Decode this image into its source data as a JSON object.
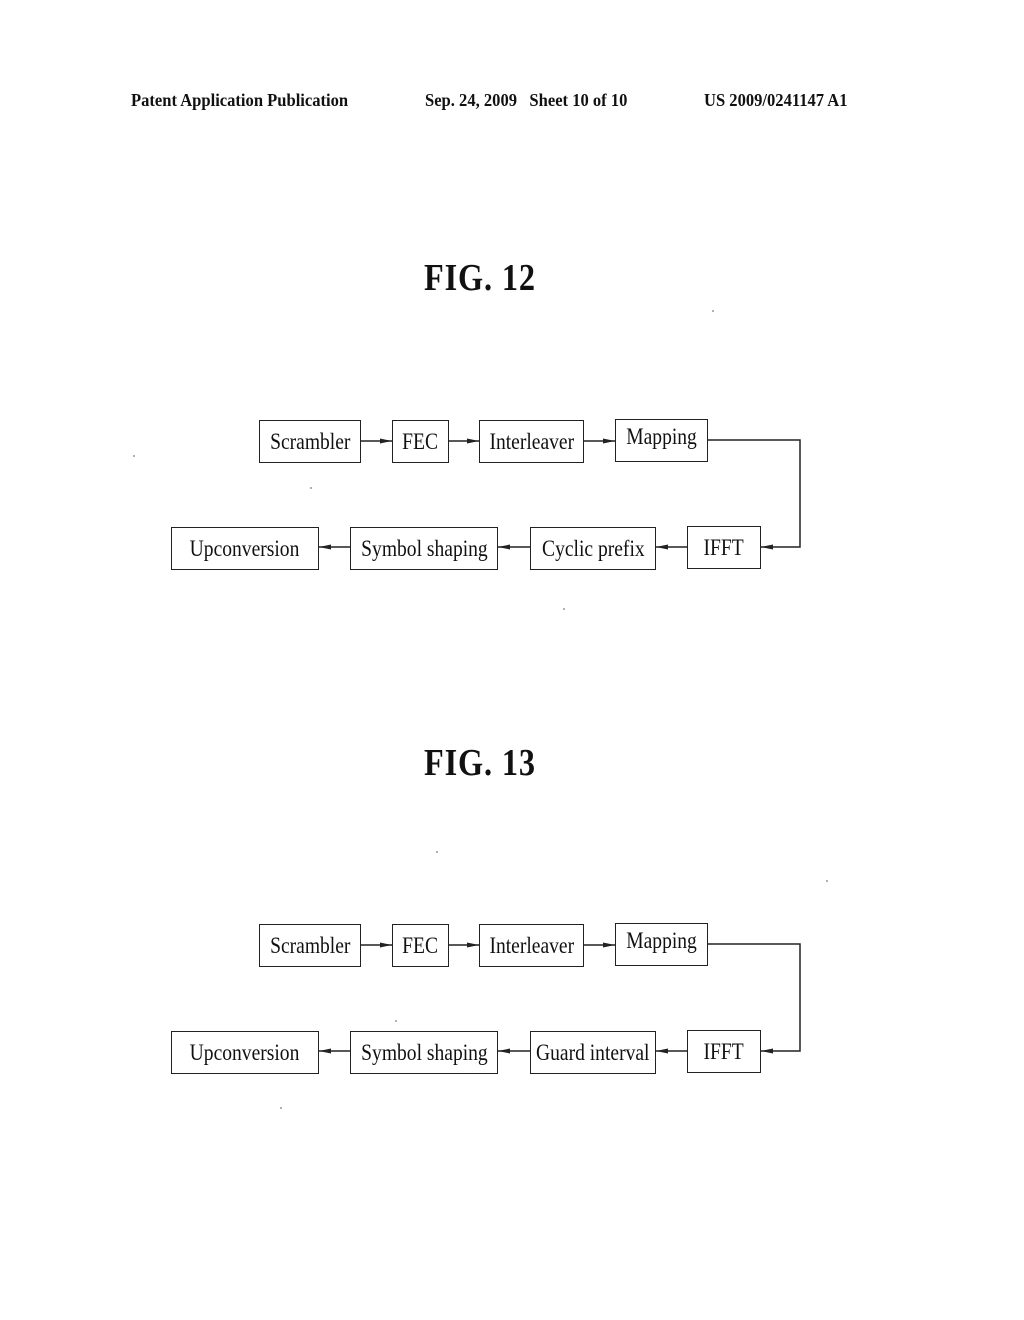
{
  "header": {
    "publication": "Patent Application Publication",
    "date_sheet": "Sep. 24, 2009   Sheet 10 of 10",
    "patent_number": "US 2009/0241147 A1"
  },
  "figures": [
    {
      "title": "FIG. 12",
      "top_row": [
        "Scrambler",
        "FEC",
        "Interleaver",
        "Mapping"
      ],
      "bottom_row": [
        "Upconversion",
        "Symbol shaping",
        "Cyclic prefix",
        "IFFT"
      ],
      "flow": [
        "Scrambler",
        "FEC",
        "Interleaver",
        "Mapping",
        "IFFT",
        "Cyclic prefix",
        "Symbol shaping",
        "Upconversion"
      ]
    },
    {
      "title": "FIG. 13",
      "top_row": [
        "Scrambler",
        "FEC",
        "Interleaver",
        "Mapping"
      ],
      "bottom_row": [
        "Upconversion",
        "Symbol shaping",
        "Guard interval",
        "IFFT"
      ],
      "flow": [
        "Scrambler",
        "FEC",
        "Interleaver",
        "Mapping",
        "IFFT",
        "Guard interval",
        "Symbol shaping",
        "Upconversion"
      ]
    }
  ]
}
